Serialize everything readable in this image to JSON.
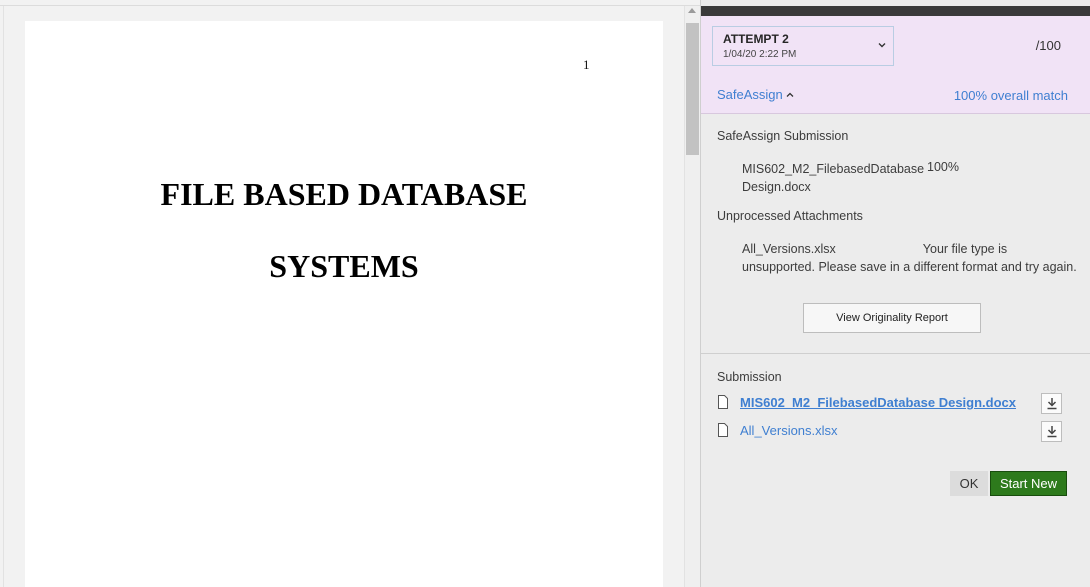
{
  "document": {
    "page_number": "1",
    "title_line_1": "FILE BASED DATABASE",
    "title_line_2": "SYSTEMS"
  },
  "panel": {
    "attempt": {
      "label": "ATTEMPT 2",
      "date": "1/04/20 2:22 PM",
      "score": "/100"
    },
    "safeassign": {
      "toggle_label": "SafeAssign",
      "overall_match": "100% overall match",
      "submission_heading": "SafeAssign Submission",
      "file_name": "MIS602_M2_FilebasedDatabase Design.docx",
      "file_match": "100%",
      "unprocessed_heading": "Unprocessed Attachments",
      "unprocessed_file": "All_Versions.xlsx",
      "unprocessed_message": "Your file type is unsupported. Please save in a different format and try again.",
      "report_button": "View Originality Report"
    },
    "submission": {
      "heading": "Submission",
      "files": [
        {
          "name": "MIS602_M2_FilebasedDatabase Design.docx"
        },
        {
          "name": "All_Versions.xlsx"
        }
      ]
    },
    "actions": {
      "ok": "OK",
      "start_new": "Start New"
    }
  },
  "icons": {
    "chevron": "chevron-down-icon",
    "caret": "chevron-up-icon",
    "file": "file-icon",
    "download": "download-icon"
  },
  "colors": {
    "link": "#3f7fd1",
    "attempt_bg": "#f1e3f6",
    "start_new_bg": "#2d7a1c"
  }
}
